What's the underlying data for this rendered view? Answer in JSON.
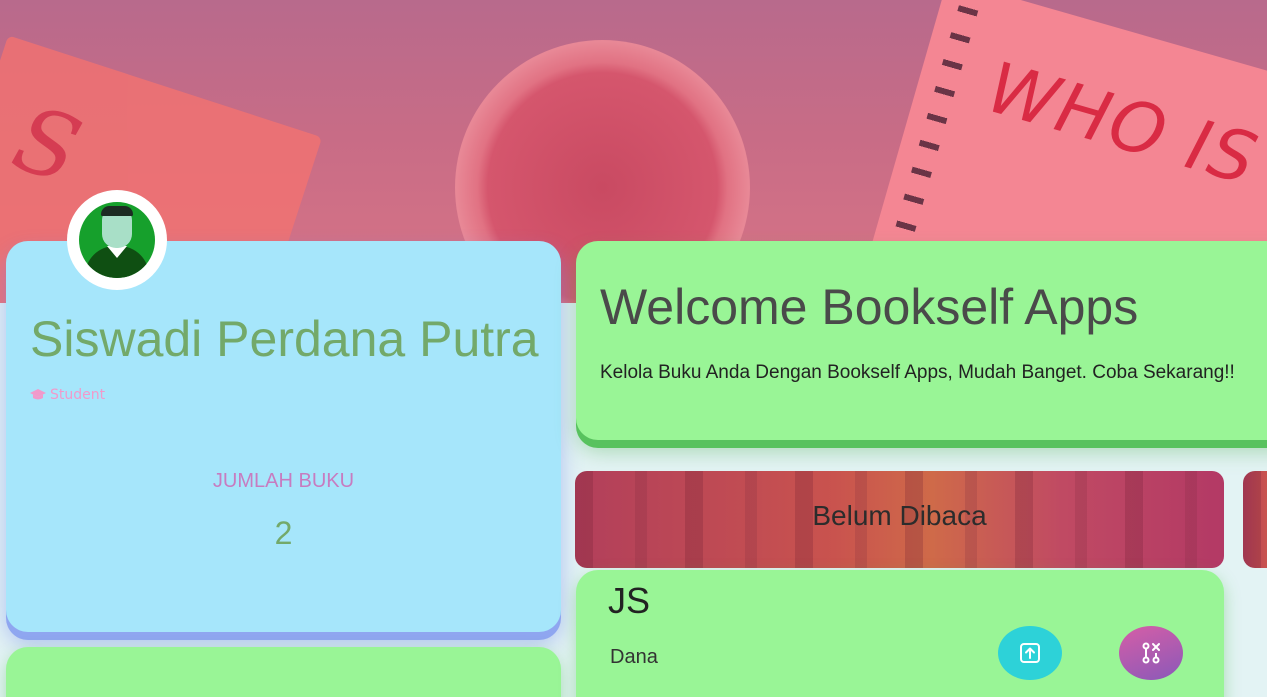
{
  "profile": {
    "name": "Siswadi Perdana Putra",
    "role": "Student",
    "role_icon": "graduation-cap-icon",
    "count_label": "JUMLAH BUKU",
    "count_value": "2",
    "avatar_icon": "user-avatar-icon"
  },
  "hero": {
    "notebook_text": "WHO IS",
    "paper_text": "S"
  },
  "welcome": {
    "title": "Welcome Bookself Apps",
    "subtitle": "Kelola Buku Anda Dengan Bookself Apps, Mudah Banget. Coba Sekarang!!"
  },
  "shelves": {
    "unread_title": "Belum Dibaca"
  },
  "books": [
    {
      "title": "JS",
      "author": "Dana",
      "move_icon": "upload-icon",
      "delete_icon": "split-icon"
    }
  ],
  "colors": {
    "profile_card": "#a6e6fb",
    "green_card": "#99f596",
    "accent_teal": "#2dd2d8",
    "accent_purple": "#8a59b9"
  }
}
